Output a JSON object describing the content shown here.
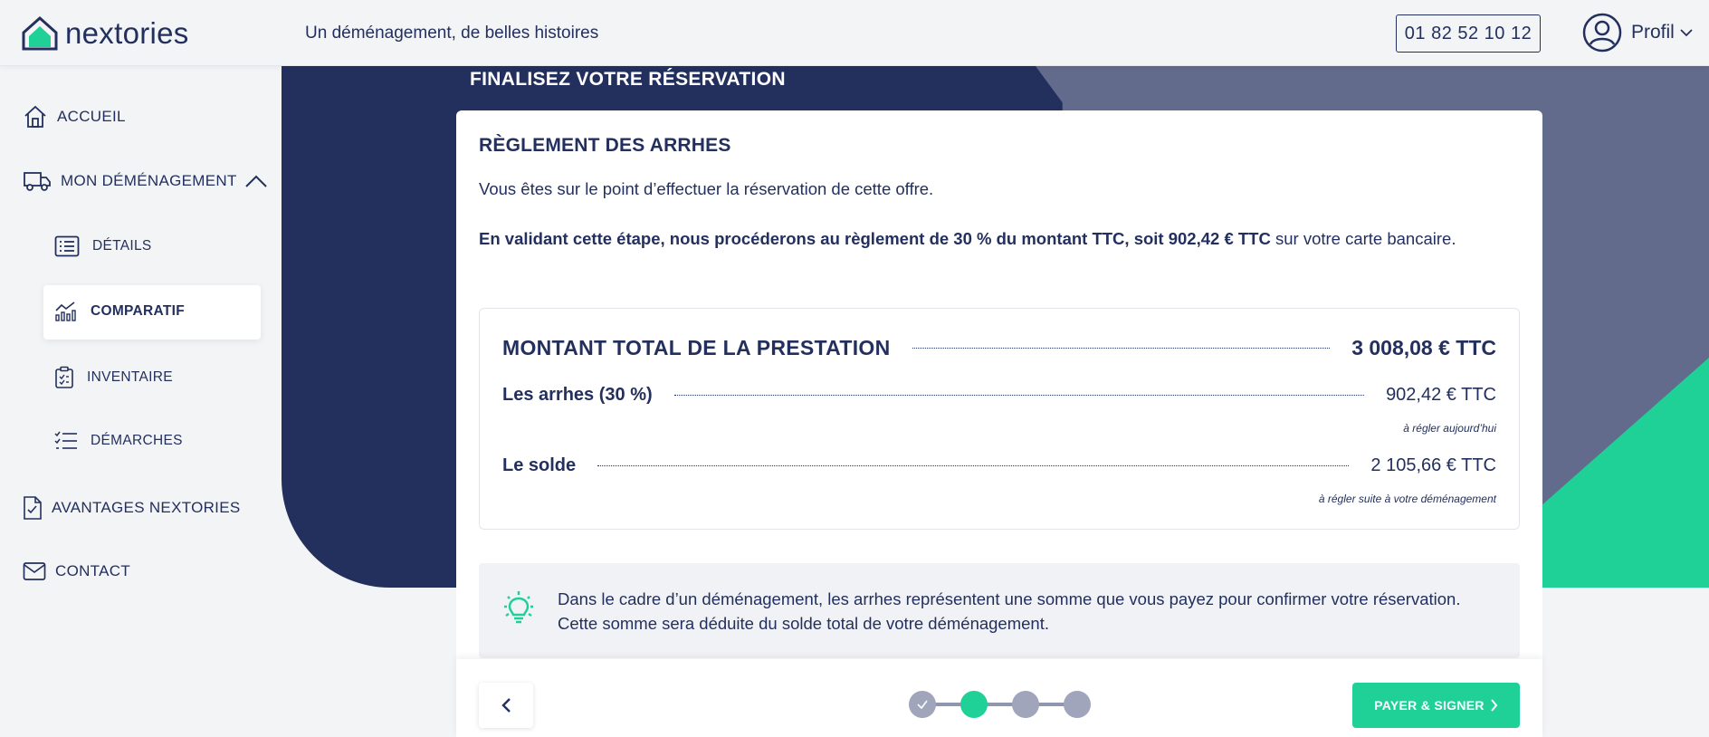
{
  "header": {
    "logo_text": "nextories",
    "tagline": "Un déménagement, de belles histoires",
    "phone": "01 82 52 10 12",
    "profile_label": "Profil"
  },
  "sidebar": {
    "items": [
      {
        "label": "ACCUEIL",
        "icon": "home-icon"
      },
      {
        "label": "MON DÉMÉNAGEMENT",
        "icon": "truck-icon",
        "expanded": true
      },
      {
        "label": "DÉTAILS",
        "icon": "list-icon"
      },
      {
        "label": "COMPARATIF",
        "icon": "chart-icon",
        "active": true
      },
      {
        "label": "INVENTAIRE",
        "icon": "clipboard-icon"
      },
      {
        "label": "DÉMARCHES",
        "icon": "checklist-icon"
      },
      {
        "label": "AVANTAGES NEXTORIES",
        "icon": "document-check-icon"
      },
      {
        "label": "CONTACT",
        "icon": "mail-icon"
      }
    ]
  },
  "main": {
    "heading": "FINALISEZ VOTRE RÉSERVATION",
    "card": {
      "title": "RÈGLEMENT DES ARRHES",
      "intro": "Vous êtes sur le point d’effectuer la réservation de cette offre.",
      "bold_text": "En validant cette étape, nous procéderons au règlement de 30 % du montant TTC, soit 902,42 € TTC",
      "rest_text": " sur votre carte bancaire.",
      "total_label": "MONTANT TOTAL DE LA PRESTATION",
      "total_value": "3 008,08 € TTC",
      "arrhes_label": "Les arrhes (30 %)",
      "arrhes_value": "902,42 € TTC",
      "arrhes_note": "à régler aujourd’hui",
      "solde_label": "Le solde",
      "solde_value": "2 105,66 € TTC",
      "solde_note": "à régler suite à votre déménagement",
      "info_text": "Dans le cadre d’un déménagement, les arrhes représentent une somme que vous payez pour confirmer votre réservation. Cette somme sera déduite du solde total de votre déménagement."
    },
    "footer": {
      "pay_label": "PAYER & SIGNER",
      "steps_total": 4,
      "current_step": 2
    }
  },
  "colors": {
    "navy": "#23305e",
    "slate": "#636b8d",
    "green": "#1fd196",
    "background": "#f3f4f6"
  }
}
